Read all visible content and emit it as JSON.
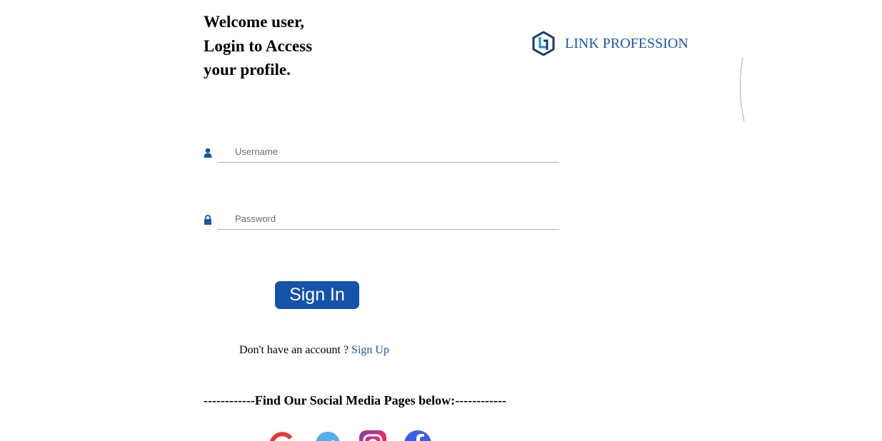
{
  "welcome": {
    "line1": "Welcome user,",
    "line2": "Login to Access",
    "line3": "your profile."
  },
  "brand": {
    "name": "LINK PROFESSION",
    "logo_icon": "link-profession-logo",
    "color": "#1a56a8"
  },
  "form": {
    "username": {
      "placeholder": "Username",
      "value": "",
      "icon": "user-icon"
    },
    "password": {
      "placeholder": "Password",
      "value": "",
      "icon": "lock-icon"
    },
    "signin_label": "Sign In",
    "signin_color": "#1552aa"
  },
  "signup": {
    "prompt": "Don't have an account ? ",
    "link_label": "Sign Up"
  },
  "social": {
    "heading": "------------Find Our Social Media Pages below:------------",
    "icons": [
      "google-icon",
      "twitter-icon",
      "instagram-icon",
      "facebook-icon"
    ]
  }
}
